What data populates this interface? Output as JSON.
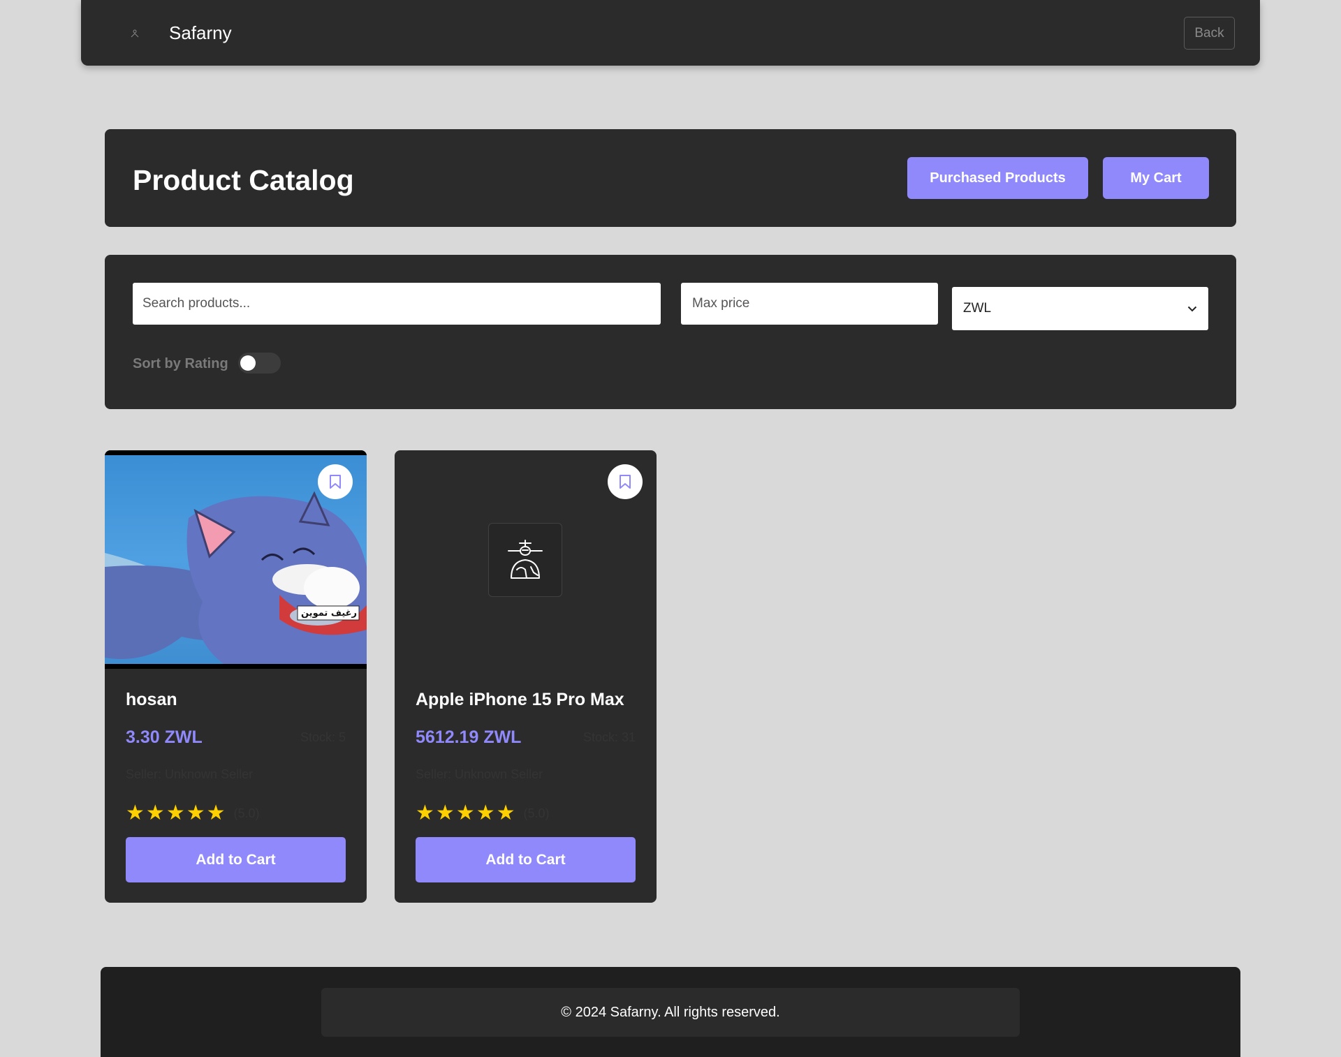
{
  "nav": {
    "brand": "Safarny",
    "back_label": "Back"
  },
  "header": {
    "title": "Product Catalog",
    "purchased_label": "Purchased Products",
    "cart_label": "My Cart"
  },
  "filters": {
    "search_placeholder": "Search products...",
    "price_placeholder": "Max price",
    "currency_selected": "ZWL",
    "sort_label": "Sort by Rating",
    "sort_enabled": false
  },
  "products": [
    {
      "name": "hosan",
      "price": "3.30 ZWL",
      "stock": "Stock: 5",
      "seller": "Seller: Unknown Seller",
      "rating_display": "(5.0)",
      "stars": 5,
      "image_caption": "رغيف تموين",
      "add_label": "Add to Cart"
    },
    {
      "name": "Apple iPhone 15 Pro Max",
      "price": "5612.19 ZWL",
      "stock": "Stock: 31",
      "seller": "Seller: Unknown Seller",
      "rating_display": "(5.0)",
      "stars": 5,
      "add_label": "Add to Cart"
    }
  ],
  "footer": {
    "copyright": "© 2024 Safarny. All rights reserved."
  },
  "colors": {
    "accent": "#9089fc",
    "panel": "#2b2b2b",
    "background": "#d9d9d9",
    "star": "#ffd000"
  }
}
